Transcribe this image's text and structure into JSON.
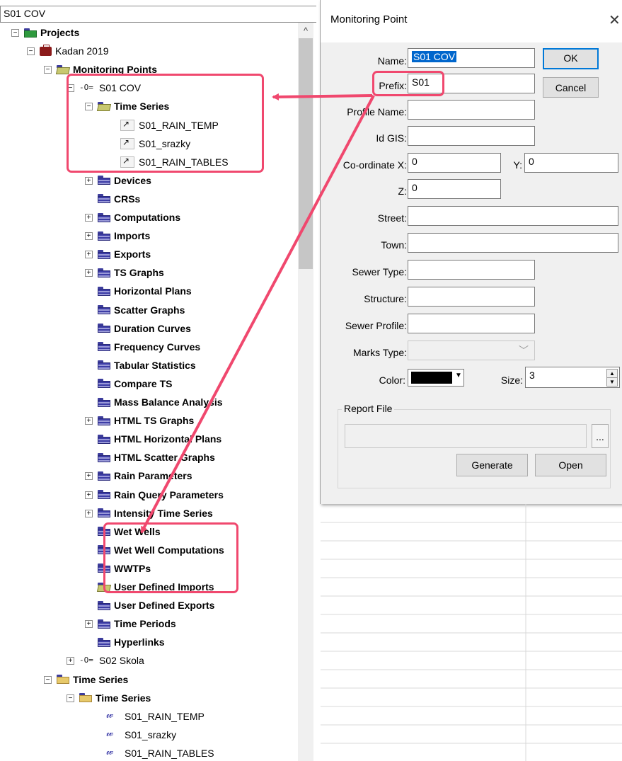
{
  "tree": {
    "header_title": "S01 COV",
    "nodes": [
      {
        "label": "Projects",
        "bold": true,
        "icon": "folder-green-icon"
      },
      {
        "label": "Kadan 2019",
        "bold": false,
        "icon": "briefcase-icon"
      },
      {
        "label": "Monitoring Points",
        "bold": true,
        "icon": "folder-open-icon"
      },
      {
        "label": "S01 COV",
        "bold": false,
        "icon": "monitoring-point-icon"
      },
      {
        "label": "Time Series",
        "bold": true,
        "icon": "folder-open-icon"
      },
      {
        "label": "S01_RAIN_TEMP",
        "bold": false,
        "icon": "time-series-link-icon"
      },
      {
        "label": "S01_srazky",
        "bold": false,
        "icon": "time-series-link-icon"
      },
      {
        "label": "S01_RAIN_TABLES",
        "bold": false,
        "icon": "time-series-link-icon"
      },
      {
        "label": "Devices",
        "bold": true,
        "icon": "folder-icon"
      },
      {
        "label": "CRSs",
        "bold": true,
        "icon": "folder-icon"
      },
      {
        "label": "Computations",
        "bold": true,
        "icon": "folder-icon"
      },
      {
        "label": "Imports",
        "bold": true,
        "icon": "folder-icon"
      },
      {
        "label": "Exports",
        "bold": true,
        "icon": "folder-icon"
      },
      {
        "label": "TS Graphs",
        "bold": true,
        "icon": "folder-icon"
      },
      {
        "label": "Horizontal Plans",
        "bold": true,
        "icon": "folder-icon"
      },
      {
        "label": "Scatter Graphs",
        "bold": true,
        "icon": "folder-icon"
      },
      {
        "label": "Duration Curves",
        "bold": true,
        "icon": "folder-icon"
      },
      {
        "label": "Frequency Curves",
        "bold": true,
        "icon": "folder-icon"
      },
      {
        "label": "Tabular Statistics",
        "bold": true,
        "icon": "folder-icon"
      },
      {
        "label": "Compare TS",
        "bold": true,
        "icon": "folder-icon"
      },
      {
        "label": "Mass Balance Analysis",
        "bold": true,
        "icon": "folder-icon"
      },
      {
        "label": "HTML TS Graphs",
        "bold": true,
        "icon": "folder-icon"
      },
      {
        "label": "HTML Horizontal Plans",
        "bold": true,
        "icon": "folder-icon"
      },
      {
        "label": "HTML Scatter Graphs",
        "bold": true,
        "icon": "folder-icon"
      },
      {
        "label": "Rain Parameters",
        "bold": true,
        "icon": "folder-icon"
      },
      {
        "label": "Rain Query Parameters",
        "bold": true,
        "icon": "folder-icon"
      },
      {
        "label": "Intensity Time Series",
        "bold": true,
        "icon": "folder-icon"
      },
      {
        "label": "Wet Wells",
        "bold": true,
        "icon": "folder-icon"
      },
      {
        "label": "Wet Well Computations",
        "bold": true,
        "icon": "folder-icon"
      },
      {
        "label": "WWTPs",
        "bold": true,
        "icon": "folder-icon"
      },
      {
        "label": "User Defined Imports",
        "bold": true,
        "icon": "folder-open-icon"
      },
      {
        "label": "User Defined Exports",
        "bold": true,
        "icon": "folder-icon"
      },
      {
        "label": "Time Periods",
        "bold": true,
        "icon": "folder-icon"
      },
      {
        "label": "Hyperlinks",
        "bold": true,
        "icon": "folder-icon"
      },
      {
        "label": "S02 Skola",
        "bold": false,
        "icon": "monitoring-point-icon"
      },
      {
        "label": "Time Series",
        "bold": true,
        "icon": "folder-yellow-icon"
      },
      {
        "label": "Time Series",
        "bold": true,
        "icon": "folder-yellow-icon"
      },
      {
        "label": "S01_RAIN_TEMP",
        "bold": false,
        "icon": "waveform-icon"
      },
      {
        "label": "S01_srazky",
        "bold": false,
        "icon": "waveform-icon"
      },
      {
        "label": "S01_RAIN_TABLES",
        "bold": false,
        "icon": "waveform-icon"
      }
    ]
  },
  "dialog": {
    "title": "Monitoring Point",
    "close_icon": "close-icon",
    "labels": {
      "name": "Name:",
      "prefix": "Prefix:",
      "profile_name": "Profile Name:",
      "id_gis": "Id GIS:",
      "coord_x": "Co-ordinate  X:",
      "coord_y": "Y:",
      "coord_z": "Z:",
      "street": "Street:",
      "town": "Town:",
      "sewer_type": "Sewer Type:",
      "structure": "Structure:",
      "sewer_profile": "Sewer Profile:",
      "marks_type": "Marks Type:",
      "color": "Color:",
      "size": "Size:",
      "report_file": "Report File"
    },
    "values": {
      "name": "S01 COV",
      "prefix": "S01",
      "profile_name": "",
      "id_gis": "",
      "x": "0",
      "y": "0",
      "z": "0",
      "street": "",
      "town": "",
      "sewer_type": "",
      "structure": "",
      "sewer_profile": "",
      "marks_type": "",
      "color": "#000000",
      "size": "3",
      "report_file": ""
    },
    "buttons": {
      "ok": "OK",
      "cancel": "Cancel",
      "browse": "...",
      "generate": "Generate",
      "open": "Open"
    }
  },
  "colors": {
    "highlight": "#f0486e",
    "selection": "#0066cc",
    "dialog_bg": "#f0f0f0"
  }
}
